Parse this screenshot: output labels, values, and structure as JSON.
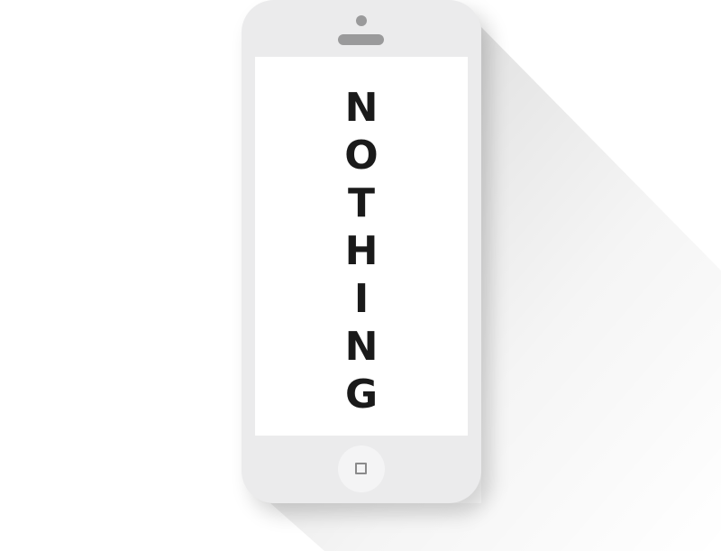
{
  "screen": {
    "letters": [
      "N",
      "O",
      "T",
      "H",
      "I",
      "N",
      "G"
    ]
  },
  "colors": {
    "phone_body": "#ebebec",
    "screen": "#ffffff",
    "text": "#1a1a1a",
    "detail_gray": "#9a9a9b",
    "home_button": "#f4f4f5"
  },
  "icons": {
    "camera": "camera-icon",
    "speaker": "speaker-icon",
    "home": "home-square-icon"
  }
}
